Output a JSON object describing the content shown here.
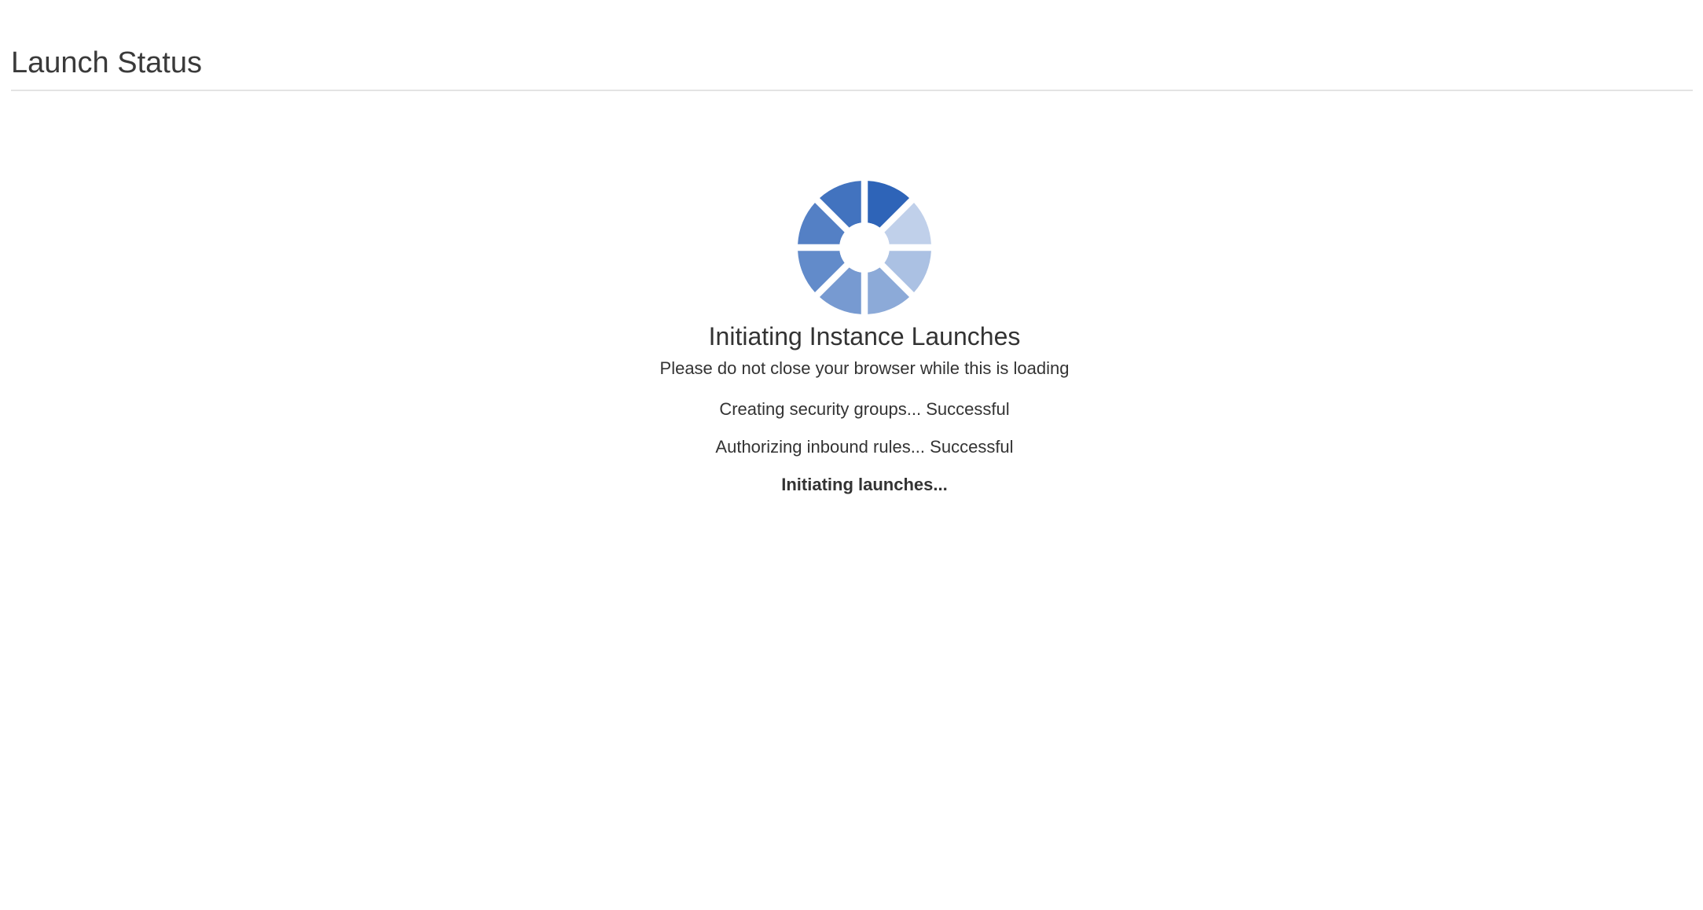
{
  "page": {
    "title": "Launch Status"
  },
  "status": {
    "spinner_icon": "loading-spinner-icon",
    "spinner_color": "#2e64b8",
    "heading": "Initiating Instance Launches",
    "subtitle": "Please do not close your browser while this is loading",
    "steps": [
      {
        "label": "Creating security groups...",
        "result": "Successful"
      },
      {
        "label": "Authorizing inbound rules...",
        "result": "Successful"
      },
      {
        "label": "Initiating launches...",
        "result": ""
      }
    ]
  }
}
